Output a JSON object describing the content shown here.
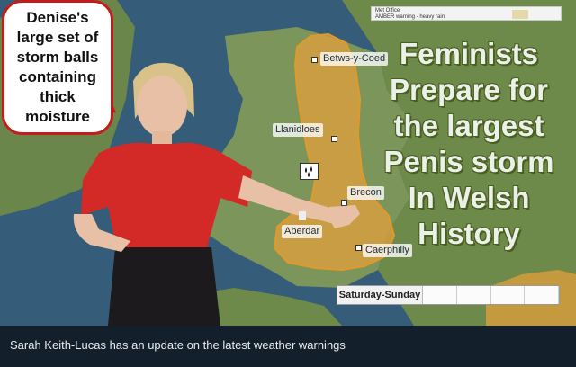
{
  "speech_bubble": {
    "text": "Denise's\nlarge set of\nstorm balls\ncontaining\nthick\nmoisture"
  },
  "warning_box": {
    "line1": "Met Office",
    "line2": "AMBER warning - heavy rain"
  },
  "headline": {
    "text": "Feminists\nPrepare for\nthe largest\nPenis storm\nIn Welsh\nHistory"
  },
  "places": {
    "betws": "Betws-y-Coed",
    "llanidloes": "Llanidloes",
    "brecon": "Brecon",
    "aberdare": "Aberdar",
    "caerphilly": "Caerphilly"
  },
  "timeline": {
    "label": "Saturday-Sunday"
  },
  "caption": {
    "text": "Sarah Keith-Lucas has an update on the latest weather warnings"
  },
  "icons": {
    "rain": "rain-drops-icon"
  },
  "colors": {
    "warning_amber": "#e8a13a",
    "land": "#6f8a49",
    "sea": "#2f5270",
    "dress": "#d42a27"
  }
}
